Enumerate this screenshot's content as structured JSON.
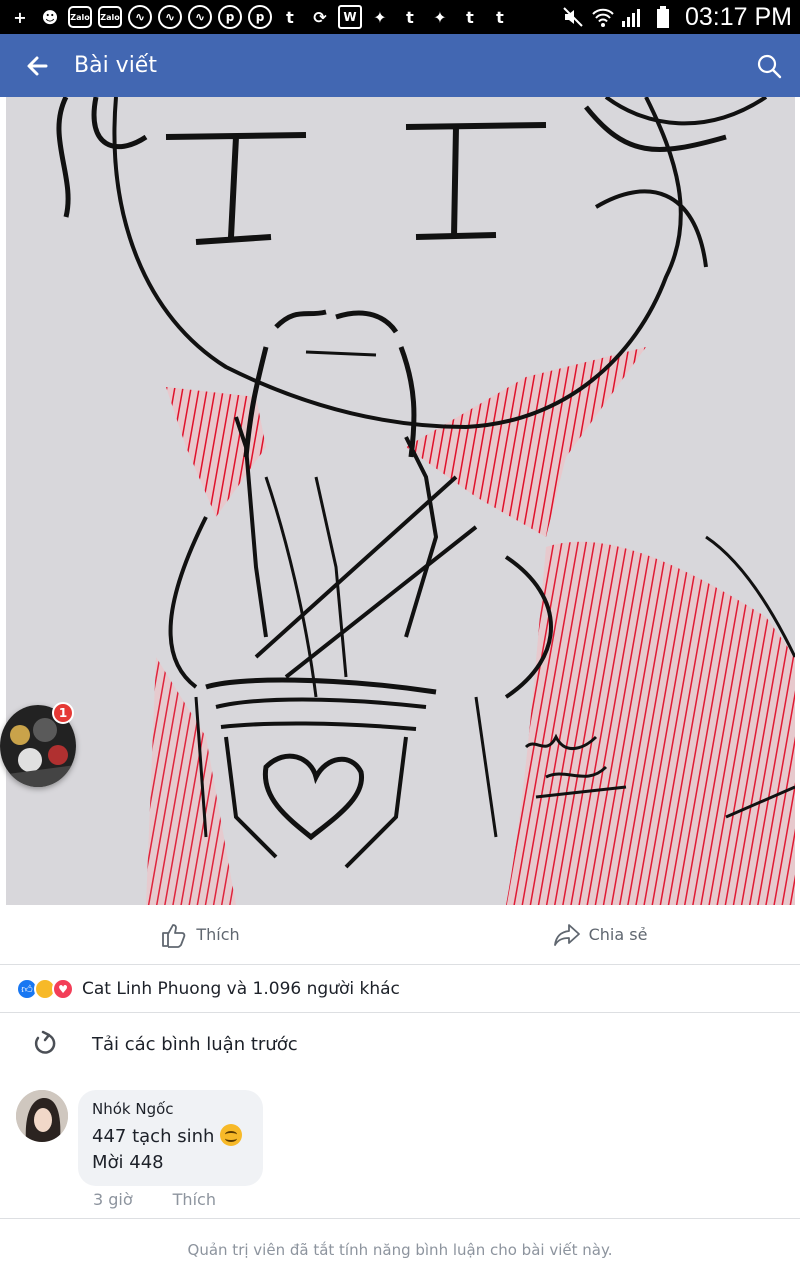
{
  "status_bar": {
    "time": "03:17 PM",
    "icons": [
      "plus-icon",
      "user-icon",
      "zalo-icon",
      "zalo-icon",
      "messenger-icon",
      "messenger-icon",
      "messenger-icon",
      "pinterest-icon",
      "pinterest-icon",
      "tumblr-icon",
      "sync-icon",
      "wattpad-icon",
      "twitter-icon",
      "tumblr-icon",
      "twitter-icon",
      "tumblr-icon",
      "tumblr-icon",
      "mute-icon",
      "wifi-icon",
      "signal-icon",
      "battery-icon"
    ],
    "zalo_label": "Zalo"
  },
  "app_bar": {
    "title": "Bài viết",
    "color": "#4267b2"
  },
  "chat_head": {
    "badge": "1"
  },
  "actions": {
    "like_label": "Thích",
    "share_label": "Chia sẻ"
  },
  "reactions": {
    "text": "Cat Linh Phuong và 1.096 người khác"
  },
  "load_previous": {
    "label": "Tải các bình luận trước"
  },
  "comment": {
    "author": "Nhók Ngốc",
    "line1": "447 tạch sinh",
    "line2": "Mời 448",
    "time": "3 giờ",
    "like_label": "Thích"
  },
  "footer": {
    "notice": "Quản trị viên đã tắt tính năng bình luận cho bài viết này."
  }
}
